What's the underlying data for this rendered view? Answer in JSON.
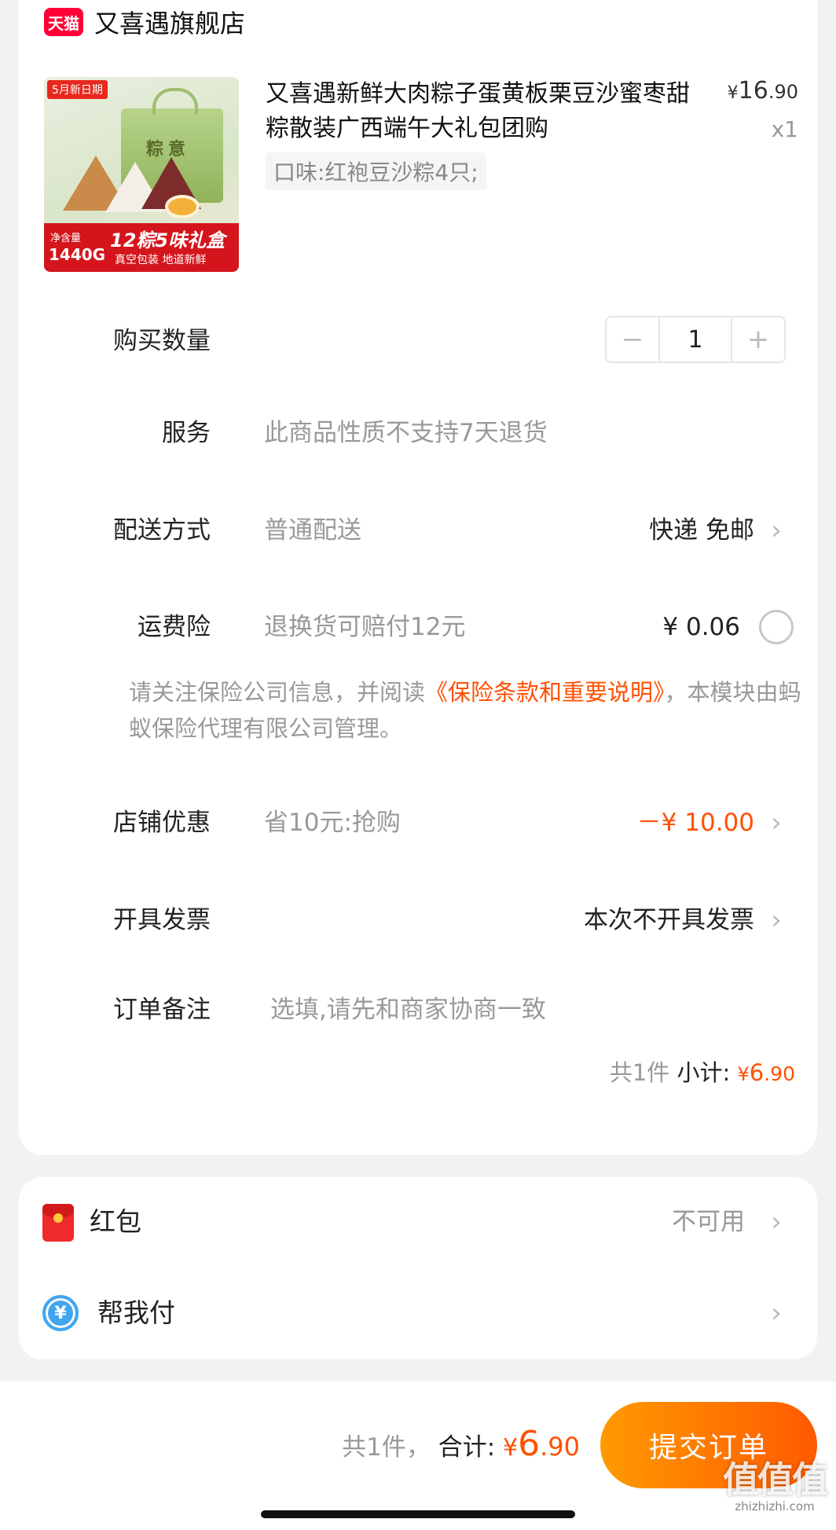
{
  "store": {
    "badge": "天猫",
    "name": "又喜遇旗舰店"
  },
  "product": {
    "thumb": {
      "tag": "5月新日期",
      "box_title": "粽意",
      "weight_label": "净含量",
      "weight": "1440G",
      "promo": "12粽5味礼盒",
      "promo_sub": "真空包装 地道新鲜"
    },
    "title": "又喜遇新鲜大肉粽子蛋黄板栗豆沙蜜枣甜粽散装广西端午大礼包团购",
    "variant": "口味:红袍豆沙粽4只;",
    "price_currency": "¥",
    "price_int": "16",
    "price_dec": ".90",
    "qty": "x1"
  },
  "quantity": {
    "label": "购买数量",
    "minus": "−",
    "value": "1",
    "plus": "+"
  },
  "service": {
    "label": "服务",
    "value": "此商品性质不支持7天退货"
  },
  "delivery": {
    "label": "配送方式",
    "value": "普通配送",
    "right": "快递 免邮"
  },
  "shipping_insurance": {
    "label": "运费险",
    "value": "退换货可赔付12元",
    "price": "¥ 0.06"
  },
  "notice": {
    "prefix": "请关注保险公司信息，并阅读",
    "link": "《保险条款和重要说明》",
    "suffix": "，本模块由蚂蚁保险代理有限公司管理。"
  },
  "store_discount": {
    "label": "店铺优惠",
    "value": "省10元:抢购",
    "amount": "－¥ 10.00"
  },
  "invoice": {
    "label": "开具发票",
    "right": "本次不开具发票"
  },
  "remark": {
    "label": "订单备注",
    "placeholder": "选填,请先和商家协商一致"
  },
  "subtotal": {
    "count": "共1件",
    "label": "小计:",
    "currency": "¥",
    "int": "6",
    "dec": ".90"
  },
  "red_packet": {
    "label": "红包",
    "status": "不可用"
  },
  "help_pay": {
    "label": "帮我付"
  },
  "footer": {
    "count": "共1件，",
    "label": "合计:",
    "currency": "¥",
    "int": "6",
    "dec": ".90",
    "submit": "提交订单"
  },
  "watermark": {
    "logo": "值值值",
    "url": "zhizhizhi.com"
  },
  "colors": {
    "accent": "#ff5000",
    "tmall": "#ff0036",
    "submit_start": "#ff9a00",
    "submit_end": "#ff5a00"
  },
  "icons": {
    "chevron": "chevron-right-icon",
    "red_packet": "red-packet-icon",
    "help_pay": "yuan-circle-icon"
  }
}
